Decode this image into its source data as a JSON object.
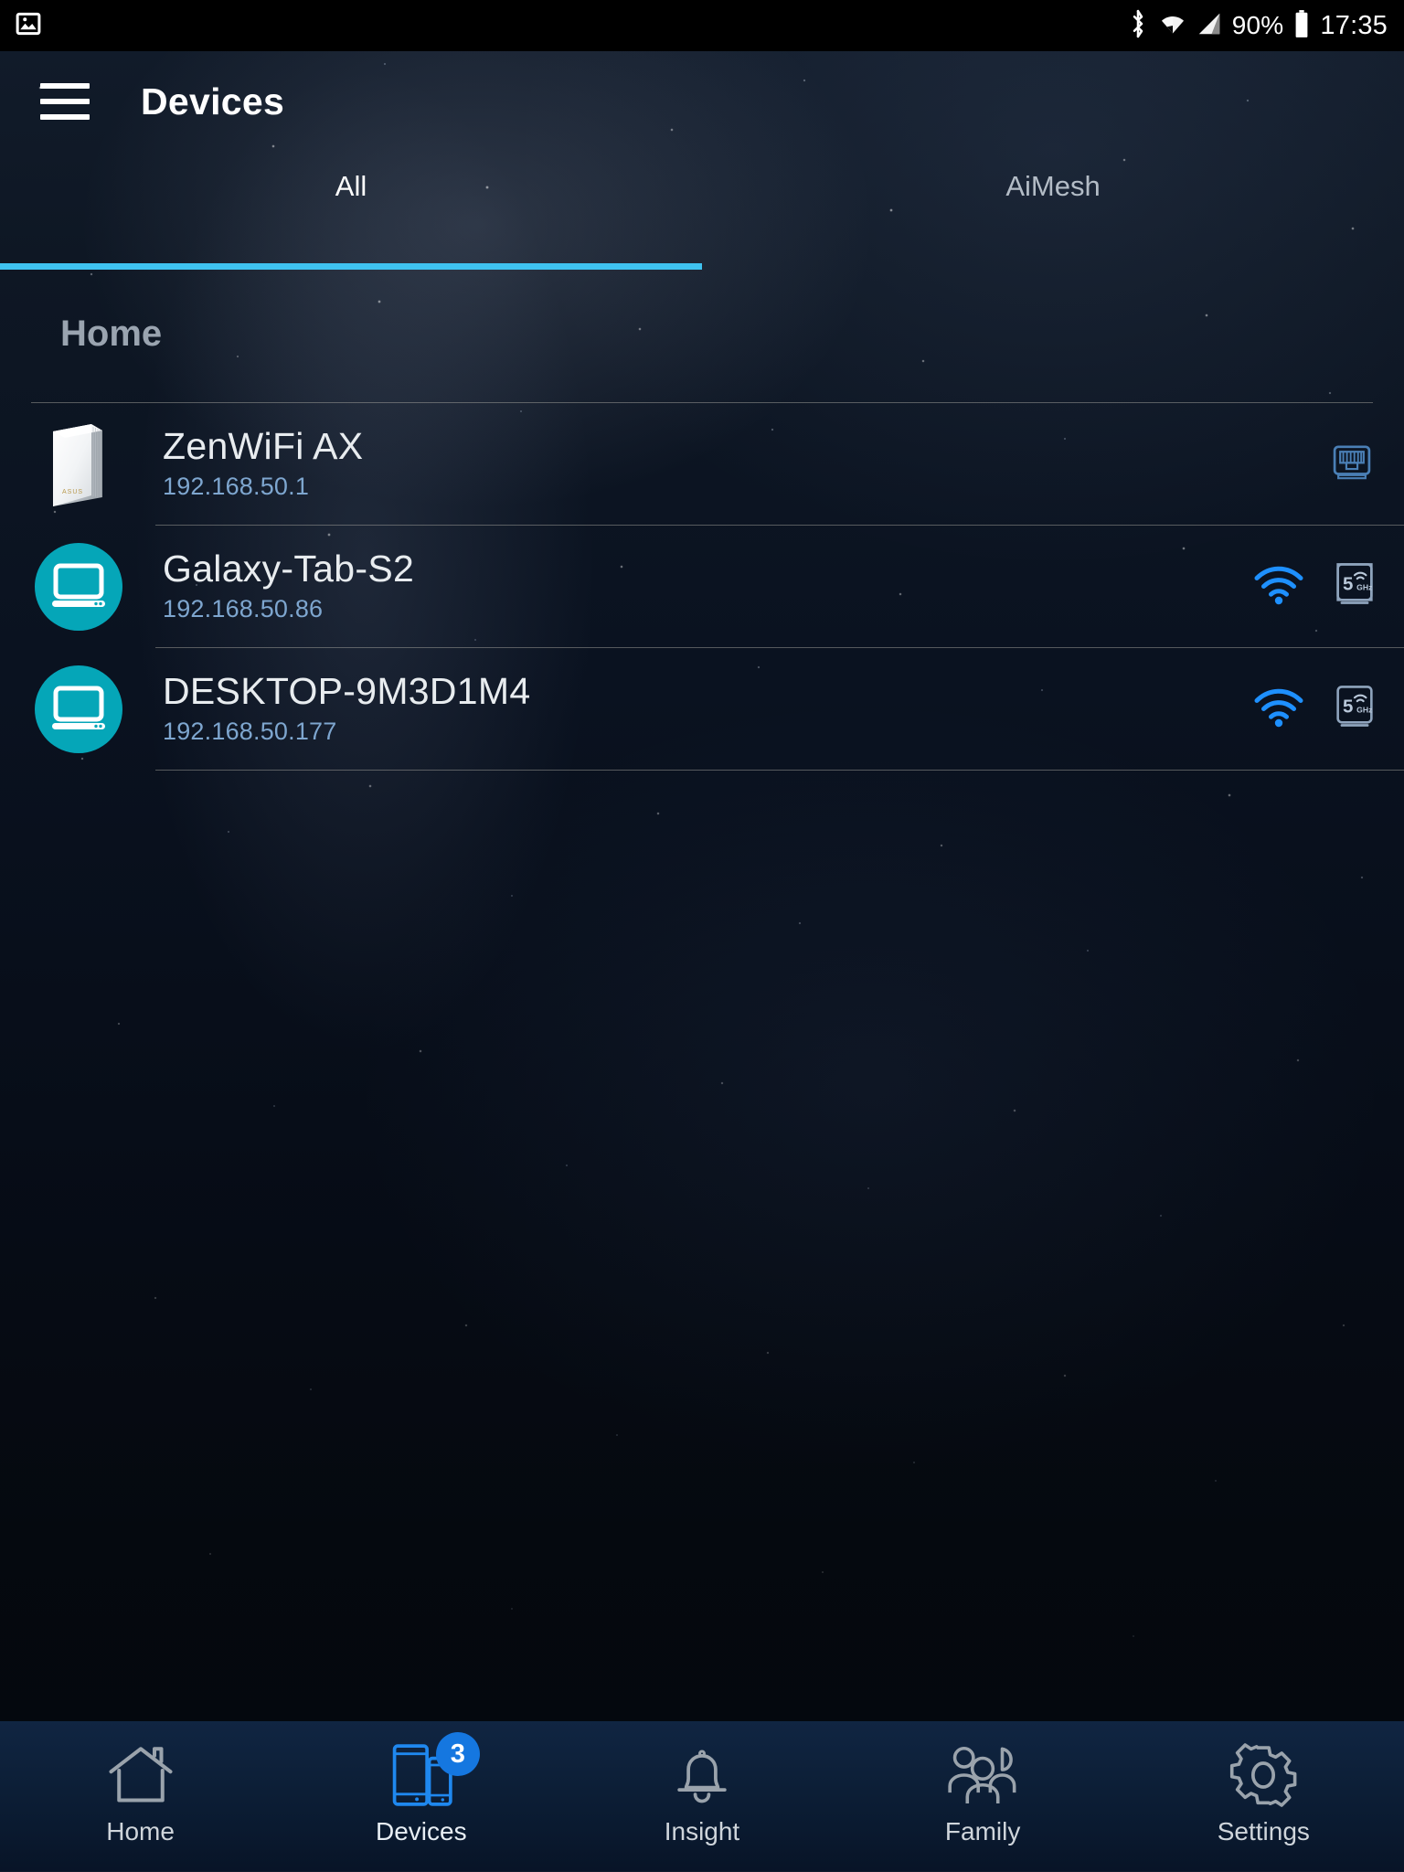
{
  "statusbar": {
    "left_icon": "image-icon",
    "icons": [
      "bluetooth-icon",
      "wifi-icon",
      "cellular-signal-icon"
    ],
    "battery_percent": "90%",
    "battery_icon": "battery-full-icon",
    "time": "17:35"
  },
  "header": {
    "menu_icon": "hamburger-menu-icon",
    "title": "Devices"
  },
  "tabs": [
    {
      "label": "All",
      "active": true
    },
    {
      "label": "AiMesh",
      "active": false
    }
  ],
  "section": {
    "title": "Home"
  },
  "devices": [
    {
      "name": "ZenWiFi AX",
      "ip": "192.168.50.1",
      "avatar": "router-image",
      "connection_icon": "ethernet-port-icon",
      "band": null
    },
    {
      "name": "Galaxy-Tab-S2",
      "ip": "192.168.50.86",
      "avatar": "computer-icon",
      "connection_icon": "wifi-signal-icon",
      "band": "5 GHz"
    },
    {
      "name": "DESKTOP-9M3D1M4",
      "ip": "192.168.50.177",
      "avatar": "computer-icon",
      "connection_icon": "wifi-signal-icon",
      "band": "5 GHz"
    }
  ],
  "bottomnav": [
    {
      "label": "Home",
      "icon": "house-icon",
      "active": false,
      "badge": null
    },
    {
      "label": "Devices",
      "icon": "devices-icon",
      "active": true,
      "badge": "3"
    },
    {
      "label": "Insight",
      "icon": "bell-icon",
      "active": false,
      "badge": null
    },
    {
      "label": "Family",
      "icon": "people-icon",
      "active": false,
      "badge": null
    },
    {
      "label": "Settings",
      "icon": "gear-icon",
      "active": false,
      "badge": null
    }
  ],
  "colors": {
    "accent_cyan": "#3fc3f0",
    "avatar_teal": "#05a6b8",
    "badge_blue": "#1577e0",
    "ip_blue": "#7ea6cf",
    "wifi_blue": "#1e90ff"
  }
}
